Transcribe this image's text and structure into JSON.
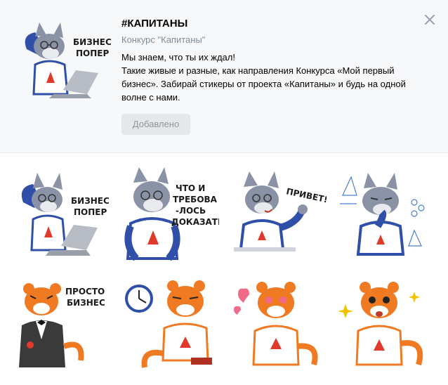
{
  "pack": {
    "title": "#КАПИТАНЫ",
    "author": "Конкурс \"Капитаны\"",
    "description_lines": [
      "Мы знаем, что ты их ждал!",
      "Такие живые и разные, как направления Конкурса «Мой первый",
      "бизнес». Забирай стикеры от проекта «Капитаны» и будь на одной",
      "волне с нами."
    ],
    "added_label": "Добавлено",
    "preview_caption": [
      "БИЗНЕС",
      "ПОПЕР"
    ]
  },
  "icons": {
    "close": "close-icon"
  },
  "colors": {
    "header_bg": "#f7f8fa",
    "wolf_fur": "#8a93a6",
    "jacket_blue": "#2f4fa8",
    "tiger_orange": "#f07a22",
    "brand_red": "#e03a2a"
  },
  "stickers": [
    {
      "character": "wolf",
      "pose": "laptop",
      "caption": [
        "БИЗНЕС",
        "ПОПЕР"
      ]
    },
    {
      "character": "wolf",
      "pose": "confident",
      "caption": [
        "ЧТО И",
        "ТРЕБОВА",
        "-ЛОСЬ",
        "ДОКАЗАТЬ"
      ]
    },
    {
      "character": "wolf",
      "pose": "waving",
      "caption": [
        "ПРИВЕТ!"
      ]
    },
    {
      "character": "wolf",
      "pose": "thinking",
      "caption": []
    },
    {
      "character": "tiger",
      "pose": "tuxedo",
      "caption": [
        "ПРОСТО",
        "БИЗНЕС"
      ]
    },
    {
      "character": "tiger",
      "pose": "clock",
      "caption": []
    },
    {
      "character": "tiger",
      "pose": "love",
      "caption": []
    },
    {
      "character": "tiger",
      "pose": "excited",
      "caption": []
    }
  ]
}
